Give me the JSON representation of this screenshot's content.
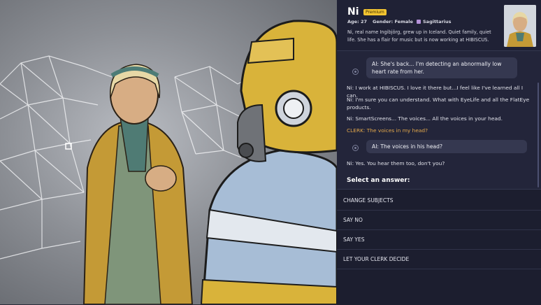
{
  "profile": {
    "name": "Ni",
    "badge": "Premium",
    "age": "Age: 27",
    "gender": "Gender: Female",
    "sign": "Sagittarius",
    "bio": "Ni, real name Ingibjörg, grew up in Iceland. Quiet family, quiet life. She has a flair for music but is now working at HIBISCUS."
  },
  "dialogue": {
    "ai_1": "AI: She's back... I'm detecting an abnormally low heart rate from her.",
    "ni_1": "Ni: I work at HIBISCUS. I love it there but...I feel like I've learned all I can.",
    "ni_2": "Ni: I'm sure you can understand. What with EyeLife and all the FlatEye products.",
    "ni_3": "Ni: SmartScreens... The voices... All the voices in your head.",
    "clerk_1": "CLERK: The voices in my head?",
    "ai_2": "AI: The voices in his head?",
    "ni_4": "Ni: Yes. You hear them too, don't you?"
  },
  "answers": {
    "title": "Select an answer:",
    "options": [
      "CHANGE SUBJECTS",
      "SAY NO",
      "SAY YES",
      "LET YOUR CLERK DECIDE"
    ]
  },
  "colors": {
    "panel": "#23253a",
    "accent_clerk": "#e3a84b",
    "badge": "#f2c431"
  }
}
